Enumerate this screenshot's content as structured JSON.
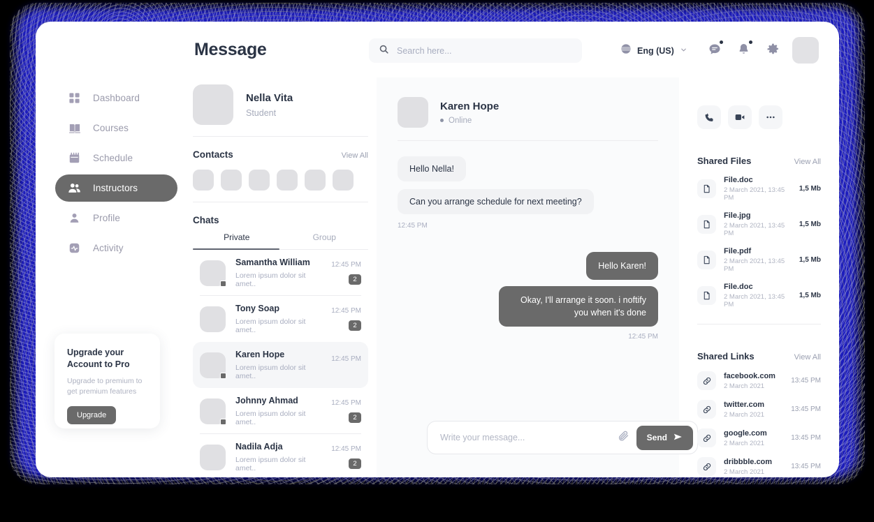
{
  "header": {
    "title": "Message",
    "search_placeholder": "Search here...",
    "language": "Eng (US)",
    "icons": [
      "globe-icon",
      "chevron-down-icon",
      "messages-icon",
      "bell-icon",
      "gear-icon"
    ]
  },
  "sidebar": {
    "items": [
      {
        "label": "Dashboard",
        "icon": "grid-icon",
        "active": false
      },
      {
        "label": "Courses",
        "icon": "book-icon",
        "active": false
      },
      {
        "label": "Schedule",
        "icon": "calendar-icon",
        "active": false
      },
      {
        "label": "Instructors",
        "icon": "users-icon",
        "active": true
      },
      {
        "label": "Profile",
        "icon": "person-icon",
        "active": false
      },
      {
        "label": "Activity",
        "icon": "activity-icon",
        "active": false
      }
    ],
    "upgrade_card": {
      "title": "Upgrade your\nAccount to Pro",
      "subtitle": "Upgrade to premium to\nget premium features",
      "button": "Upgrade"
    }
  },
  "list_panel": {
    "profile": {
      "name": "Nella Vita",
      "role": "Student"
    },
    "contacts": {
      "title": "Contacts",
      "view_all": "View All",
      "count": 6
    },
    "chats": {
      "title": "Chats",
      "tabs": [
        {
          "label": "Private",
          "active": true
        },
        {
          "label": "Group",
          "active": false
        }
      ],
      "rows": [
        {
          "name": "Samantha William",
          "preview": "Lorem ipsum dolor sit amet..",
          "time": "12:45 PM",
          "badge": "2",
          "selected": false,
          "status": true
        },
        {
          "name": "Tony Soap",
          "preview": "Lorem ipsum dolor sit amet..",
          "time": "12:45 PM",
          "badge": "2",
          "selected": false,
          "status": false
        },
        {
          "name": "Karen Hope",
          "preview": "Lorem ipsum dolor sit amet..",
          "time": "12:45 PM",
          "badge": "",
          "selected": true,
          "status": true
        },
        {
          "name": "Johnny Ahmad",
          "preview": "Lorem ipsum dolor sit amet..",
          "time": "12:45 PM",
          "badge": "2",
          "selected": false,
          "status": true
        },
        {
          "name": "Nadila Adja",
          "preview": "Lorem ipsum dolor sit amet..",
          "time": "12:45 PM",
          "badge": "2",
          "selected": false,
          "status": false
        }
      ]
    }
  },
  "conversation": {
    "name": "Karen Hope",
    "status": "Online",
    "messages": [
      {
        "text": "Hello Nella!",
        "side": "in"
      },
      {
        "text": "Can you arrange schedule for next meeting?",
        "side": "in"
      }
    ],
    "incoming_time": "12:45 PM",
    "outgoing": [
      {
        "text": "Hello Karen!"
      },
      {
        "text": "Okay, I'll arrange it soon. i noftify you when it's done"
      }
    ],
    "outgoing_time": "12:45 PM",
    "composer": {
      "placeholder": "Write your message...",
      "send_label": "Send"
    }
  },
  "right_panel": {
    "actions": [
      "phone-icon",
      "video-icon",
      "more-icon"
    ],
    "shared_files": {
      "title": "Shared Files",
      "view_all": "View All",
      "items": [
        {
          "name": "File.doc",
          "meta": "2 March 2021, 13:45 PM",
          "size": "1,5 Mb"
        },
        {
          "name": "File.jpg",
          "meta": "2 March 2021, 13:45 PM",
          "size": "1,5 Mb"
        },
        {
          "name": "File.pdf",
          "meta": "2 March 2021, 13:45 PM",
          "size": "1,5 Mb"
        },
        {
          "name": "File.doc",
          "meta": "2 March 2021, 13:45 PM",
          "size": "1,5 Mb"
        }
      ]
    },
    "shared_links": {
      "title": "Shared Links",
      "view_all": "View All",
      "items": [
        {
          "name": "facebook.com",
          "meta": "2 March 2021",
          "time": "13:45 PM"
        },
        {
          "name": "twitter.com",
          "meta": "2 March 2021",
          "time": "13:45 PM"
        },
        {
          "name": "google.com",
          "meta": "2 March 2021",
          "time": "13:45 PM"
        },
        {
          "name": "dribbble.com",
          "meta": "2 March 2021",
          "time": "13:45 PM"
        }
      ]
    }
  },
  "colors": {
    "accent": "#6a6a6a",
    "text": "#2b3445",
    "muted": "#a9aec0",
    "glow": "#1a1ab8"
  }
}
